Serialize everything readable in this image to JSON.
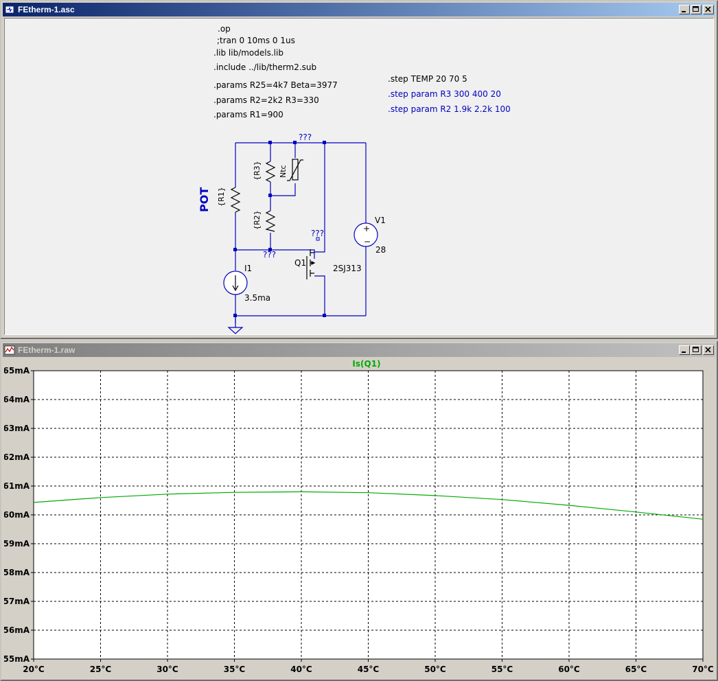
{
  "schematic_window": {
    "title": "FEtherm-1.asc",
    "directives": [
      ".op",
      ";tran 0 10ms 0 1us",
      ".lib lib/models.lib",
      ".include ../lib/therm2.sub",
      ".params R25=4k7 Beta=3977",
      ".params R2=2k2 R3=330",
      ".params R1=900"
    ],
    "step_directives": [
      ".step TEMP 20 70 5",
      ".step param R3 300 400 20",
      ".step param R2 1.9k 2.2k 100"
    ],
    "labels": {
      "pot": "POT",
      "r1": "{R1}",
      "r2": "{R2}",
      "r3": "{R3}",
      "ntc": "Ntc",
      "node_top": "???",
      "node_mid": "???",
      "node_q1": "???",
      "q1_name": "Q1",
      "q1_model": "2SJ313",
      "v1_name": "V1",
      "v1_value": "28",
      "i1_name": "I1",
      "i1_value": "3.5ma"
    },
    "colors": {
      "wire": "#0000c0",
      "text": "#000000",
      "blue_text": "#0000c0"
    }
  },
  "plot_window": {
    "title": "FEtherm-1.raw"
  },
  "chart_data": {
    "type": "line",
    "title": "",
    "xlabel": "",
    "ylabel": "",
    "xlim": [
      20,
      70
    ],
    "ylim": [
      55,
      65
    ],
    "x_ticks": [
      "20°C",
      "25°C",
      "30°C",
      "35°C",
      "40°C",
      "45°C",
      "50°C",
      "55°C",
      "60°C",
      "65°C",
      "70°C"
    ],
    "y_ticks": [
      "55mA",
      "56mA",
      "57mA",
      "58mA",
      "59mA",
      "60mA",
      "61mA",
      "62mA",
      "63mA",
      "64mA",
      "65mA"
    ],
    "grid": true,
    "legend": "top-center",
    "series": [
      {
        "name": "Is(Q1)",
        "color": "#00aa00",
        "x": [
          20,
          25,
          30,
          35,
          40,
          45,
          50,
          55,
          60,
          65,
          70
        ],
        "values": [
          60.43,
          60.6,
          60.72,
          60.78,
          60.8,
          60.77,
          60.67,
          60.53,
          60.33,
          60.1,
          59.85
        ]
      }
    ]
  }
}
